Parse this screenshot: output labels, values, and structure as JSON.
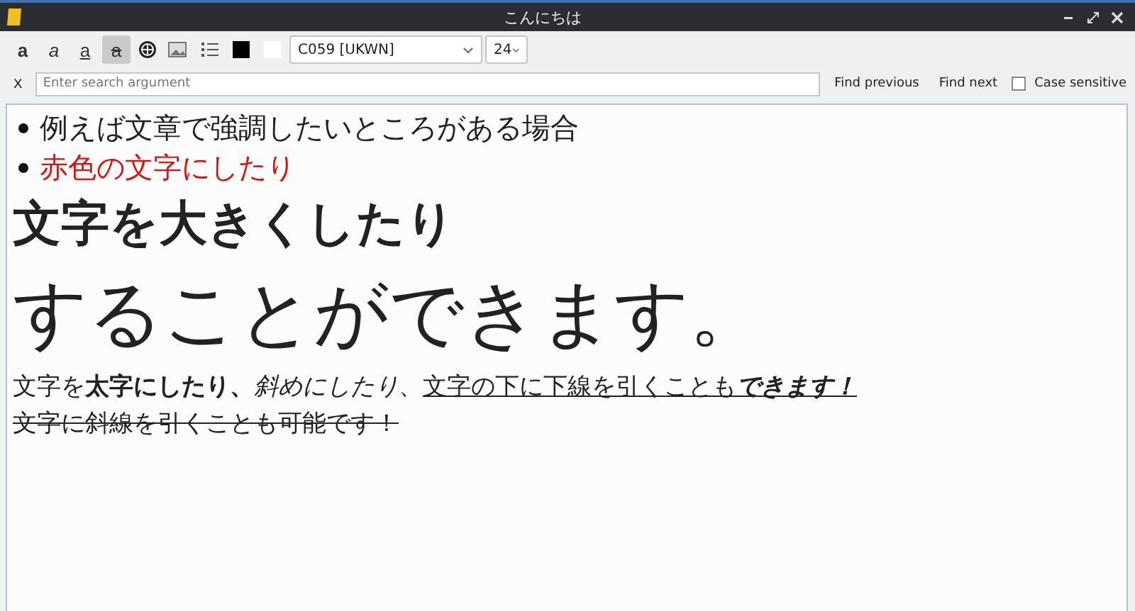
{
  "window": {
    "title": "こんにちは"
  },
  "toolbar": {
    "buttons": [
      {
        "kind": "bold",
        "label": "a",
        "selected": false
      },
      {
        "kind": "italic",
        "label": "a",
        "selected": false
      },
      {
        "kind": "underline",
        "label": "a",
        "selected": false
      },
      {
        "kind": "strike",
        "label": "a",
        "selected": true
      },
      {
        "kind": "globe",
        "selected": false
      },
      {
        "kind": "image",
        "selected": false
      },
      {
        "kind": "list",
        "selected": false
      }
    ],
    "swatches": [
      {
        "color": "#000000"
      },
      {
        "color": "#ffffff"
      }
    ],
    "font": "C059 [UKWN]",
    "size": "24"
  },
  "search": {
    "close": "X",
    "placeholder": "Enter search argument",
    "find_previous": "Find previous",
    "find_next": "Find next",
    "case_sensitive": {
      "label": "Case sensitive",
      "checked": false
    }
  },
  "document": [
    {
      "kind": "bullet",
      "text": "例えば文章で強調したいところがある場合",
      "color": "#222222"
    },
    {
      "kind": "bullet",
      "text": "赤色の文字にしたり",
      "color": "#dd1111"
    },
    {
      "kind": "heading",
      "text": "文字を大きくしたり"
    },
    {
      "kind": "huge",
      "text": "することができます。"
    },
    {
      "kind": "runs",
      "runs": [
        {
          "text": "文字を",
          "kind": "plain"
        },
        {
          "text": "太字にしたり、",
          "kind": "bold"
        },
        {
          "text": "斜めにしたり",
          "kind": "italic"
        },
        {
          "text": "、",
          "kind": "plain"
        },
        {
          "text": "文字の下に下線を引くことも",
          "kind": "underline"
        },
        {
          "text": "できます！",
          "kind": "emphasis"
        }
      ]
    },
    {
      "kind": "runs",
      "runs": [
        {
          "text": "文字に斜線を引くことも可能です！",
          "kind": "strike"
        }
      ]
    }
  ]
}
